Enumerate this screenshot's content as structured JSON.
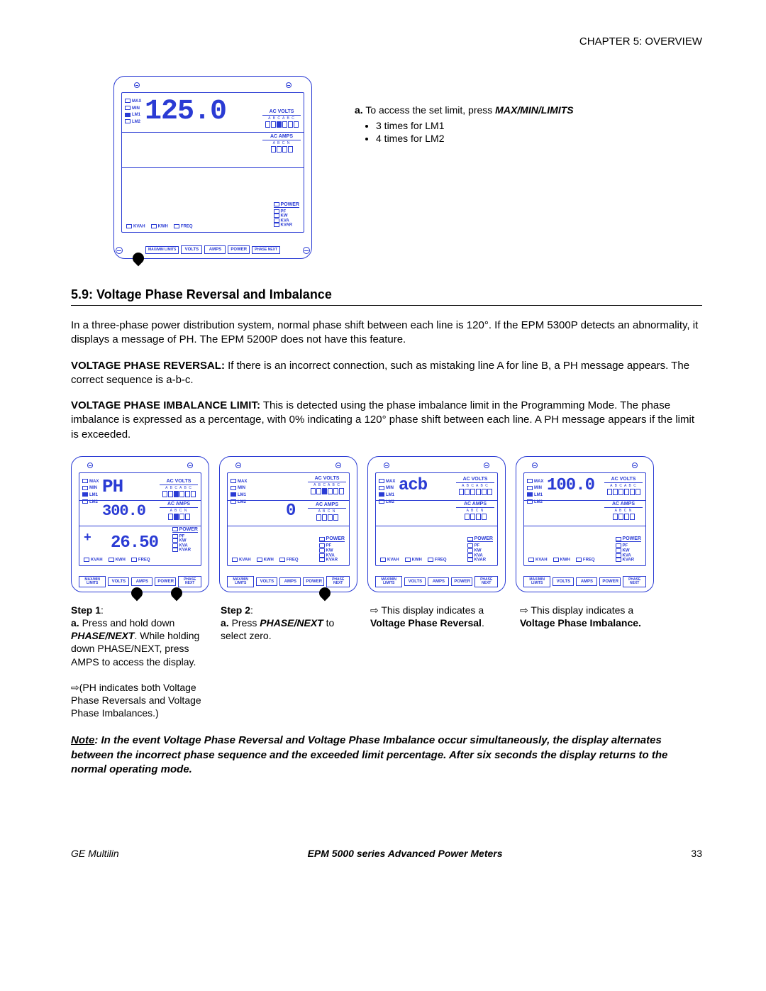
{
  "chapter_header": "CHAPTER 5: OVERVIEW",
  "top": {
    "access_a": "a.",
    "access_text": "To access the set limit, press ",
    "access_key": "MAX/MIN/LIMITS",
    "bullets": [
      "3 times for LM1",
      "4 times for LM2"
    ]
  },
  "section": {
    "number_title": "5.9: Voltage Phase Reversal and Imbalance",
    "intro": "In a three-phase power distribution system, normal phase shift between each line is 120°. If the EPM 5300P detects an abnormality, it displays a message of PH.  The EPM 5200P does not have this feature.",
    "reversal_label": "VOLTAGE PHASE REVERSAL:",
    "reversal_text": " If there is an incorrect connection, such as mistaking line A for line B, a PH message appears.  The correct sequence is a-b-c.",
    "imbalance_label": "VOLTAGE PHASE IMBALANCE LIMIT:",
    "imbalance_text": " This is detected using the phase imbalance limit in the Programming Mode.  The phase imbalance is expressed as a percentage, with 0% indicating a 120° phase shift between each line.  A PH message appears if the limit is exceeded."
  },
  "steps": {
    "s1_title": "Step 1",
    "s1_a": "a.",
    "s1_a_text": " Press and hold down ",
    "s1_key": "PHASE/NEXT",
    "s1_rest": ". While holding down PHASE/NEXT, press AMPS to access the display.",
    "s1_note": "⇨(PH indicates both Voltage Phase Reversals and Voltage Phase Imbalances.)",
    "s2_title": "Step 2",
    "s2_a": "a.",
    "s2_text": " Press ",
    "s2_key": "PHASE/NEXT",
    "s2_rest": " to select zero.",
    "s3_lead": "⇨ This display indicates a ",
    "s3_bold": "Voltage Phase Reversal",
    "s4_lead": "⇨ This display indicates a ",
    "s4_bold": "Voltage Phase Imbalance."
  },
  "note": {
    "label": "Note",
    "body": ":  In the event Voltage Phase Reversal and Voltage Phase Imbalance occur simultaneously, the display alternates between the incorrect phase sequence and the exceeded limit percentage. After six seconds the display returns to the normal operating mode."
  },
  "footer": {
    "left": "GE Multilin",
    "center": "EPM 5000 series Advanced Power Meters",
    "page": "33"
  },
  "meter": {
    "ac_volts": "AC VOLTS",
    "ac_amps": "AC AMPS",
    "power": "POWER",
    "abcabc": "A B C A B C",
    "abcn": "A B C N",
    "max": "MAX",
    "min": "MIN",
    "lm1": "LM1",
    "lm2": "LM2",
    "kvah": "KVAH",
    "kwh": "KWH",
    "freq": "FREQ",
    "pf": "PF",
    "kw": "KW",
    "kva": "KVA",
    "kvar": "KVAR",
    "btn_maxmin": "MAX/MIN LIMITS",
    "btn_volts": "VOLTS",
    "btn_amps": "AMPS",
    "btn_power": "POWER",
    "btn_phase": "PHASE NEXT",
    "displays": {
      "top_big": "125.0",
      "p1_volts": "PH",
      "p1_amps": "300.0",
      "p1_power": "26.50",
      "p1_plus": "+",
      "p2_amps": "0",
      "p3_volts": "acb",
      "p4_volts": "100.0"
    }
  }
}
